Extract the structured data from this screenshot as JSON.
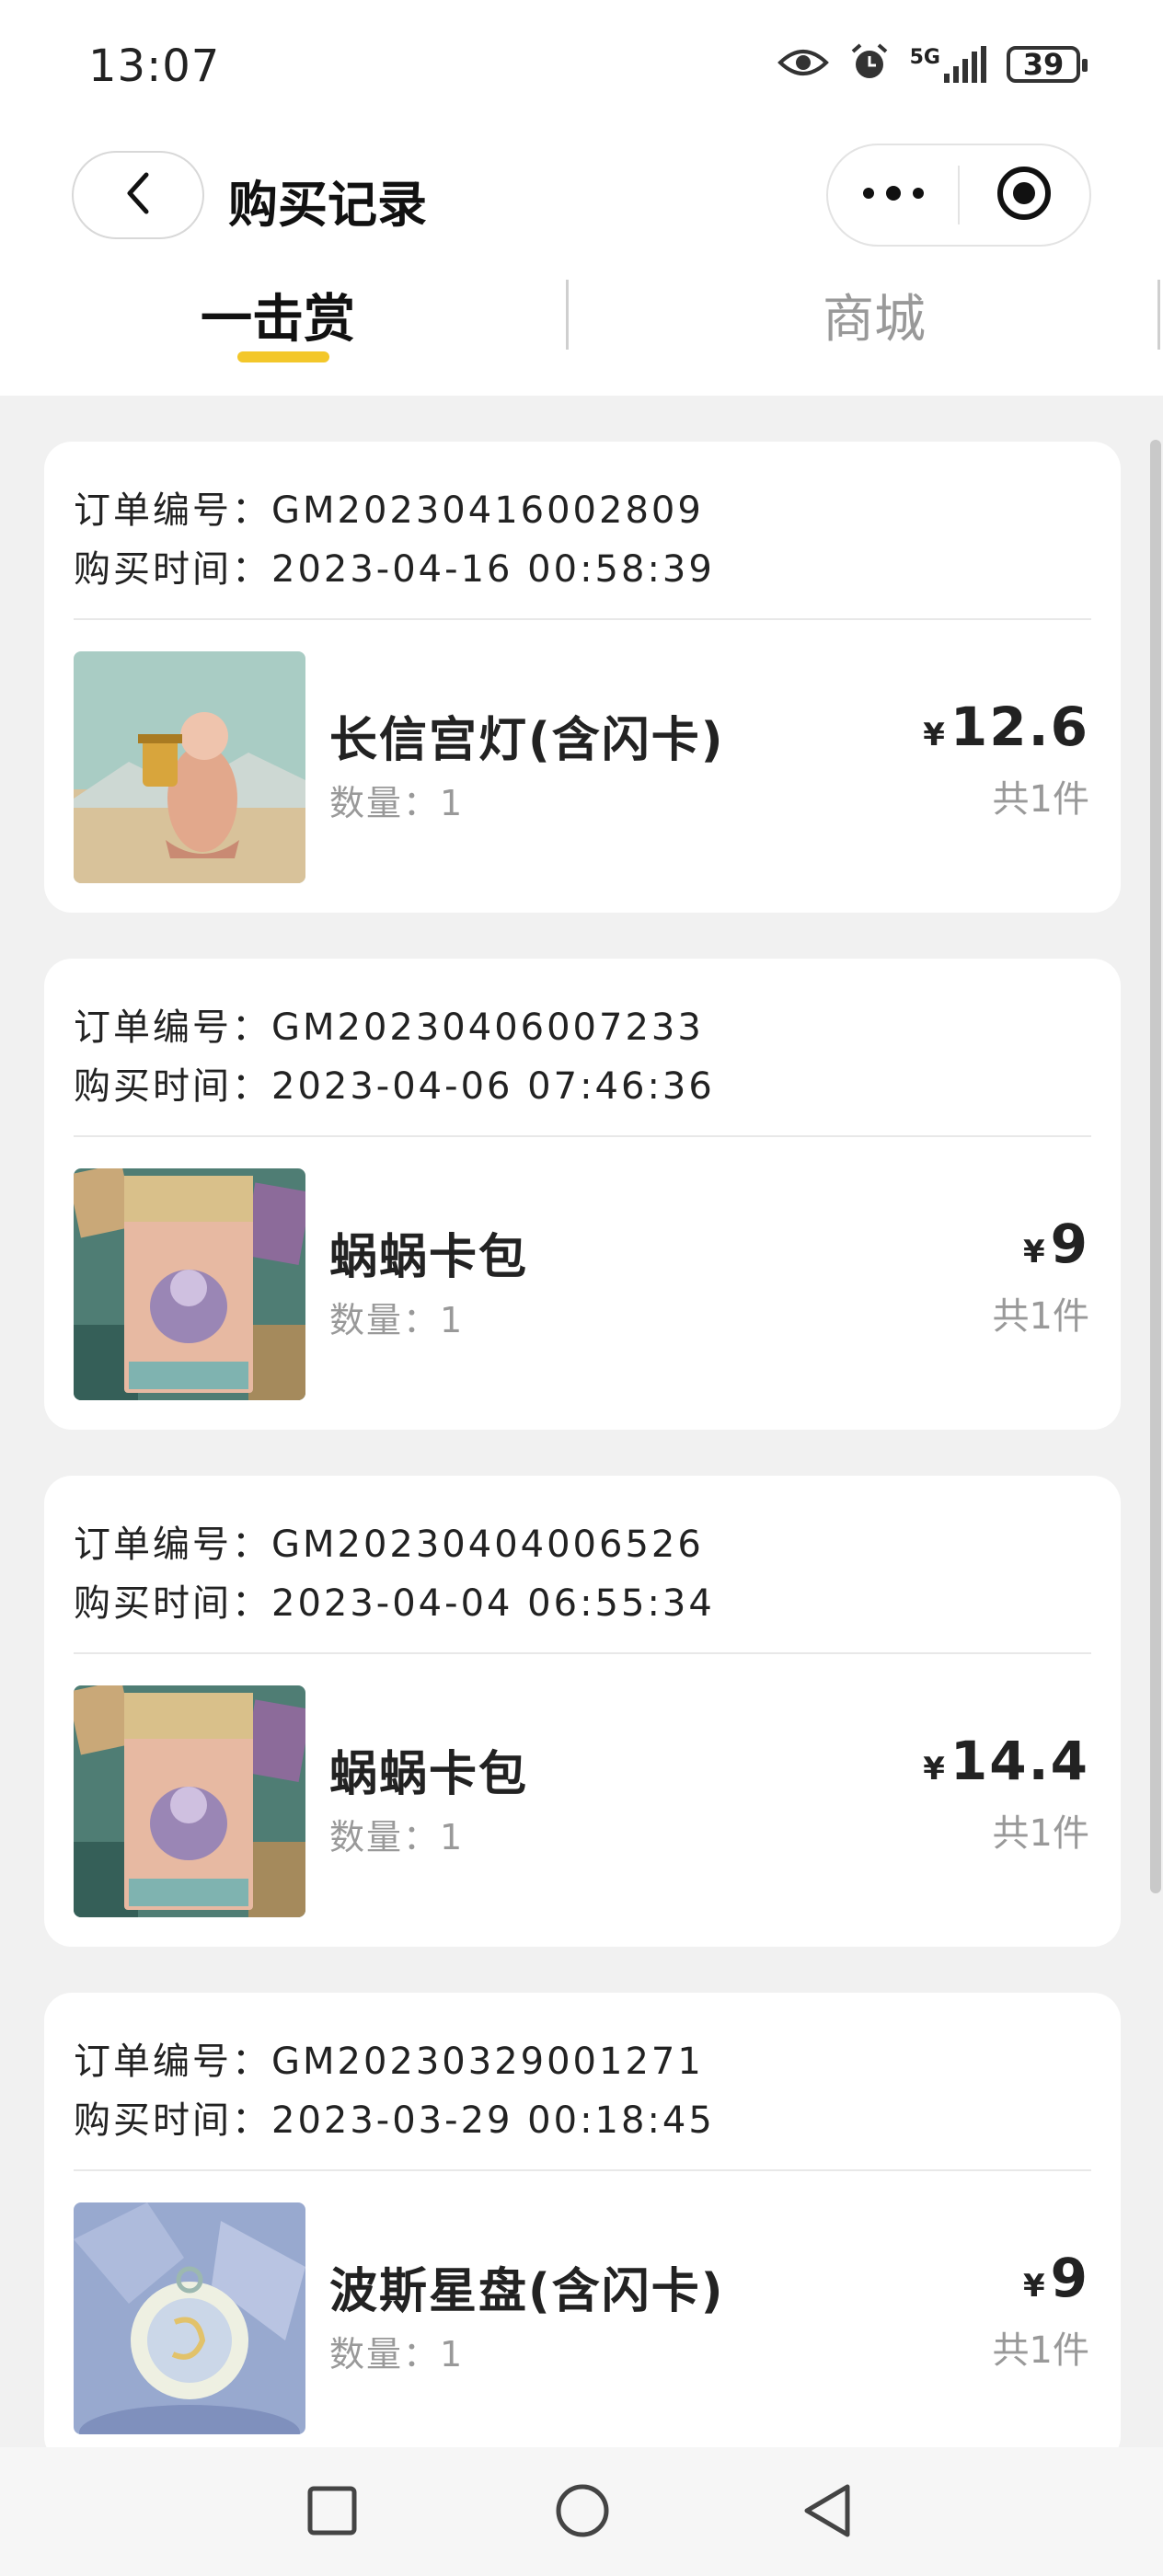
{
  "status_bar": {
    "time": "13:07",
    "network": "5G",
    "battery": "39"
  },
  "header": {
    "title": "购买记录"
  },
  "tabs": [
    {
      "label": "一击赏",
      "active": true
    },
    {
      "label": "商城",
      "active": false
    }
  ],
  "orders": [
    {
      "order_label": "订单编号：",
      "order_no": "GM20230416002809",
      "time_label": "购买时间：",
      "time": "2023-04-16 00:58:39",
      "product_name": "长信宫灯(含闪卡)",
      "qty_label": "数量：",
      "qty": "1",
      "currency": "¥",
      "price": "12.6",
      "count": "共1件"
    },
    {
      "order_label": "订单编号：",
      "order_no": "GM20230406007233",
      "time_label": "购买时间：",
      "time": "2023-04-06 07:46:36",
      "product_name": "蜗蜗卡包",
      "qty_label": "数量：",
      "qty": "1",
      "currency": "¥",
      "price": "9",
      "count": "共1件"
    },
    {
      "order_label": "订单编号：",
      "order_no": "GM20230404006526",
      "time_label": "购买时间：",
      "time": "2023-04-04 06:55:34",
      "product_name": "蜗蜗卡包",
      "qty_label": "数量：",
      "qty": "1",
      "currency": "¥",
      "price": "14.4",
      "count": "共1件"
    },
    {
      "order_label": "订单编号：",
      "order_no": "GM20230329001271",
      "time_label": "购买时间：",
      "time": "2023-03-29 00:18:45",
      "product_name": "波斯星盘(含闪卡)",
      "qty_label": "数量：",
      "qty": "1",
      "currency": "¥",
      "price": "9",
      "count": "共1件"
    }
  ],
  "colors": {
    "accent": "#f3c72a",
    "background": "#f1f1f1",
    "card": "#ffffff",
    "muted_text": "#999999"
  },
  "icons": [
    "eye-icon",
    "alarm-icon",
    "signal-icon",
    "battery-icon",
    "back-arrow-icon",
    "more-dots-icon",
    "target-close-icon",
    "square-nav-icon",
    "circle-nav-icon",
    "triangle-back-nav-icon"
  ]
}
